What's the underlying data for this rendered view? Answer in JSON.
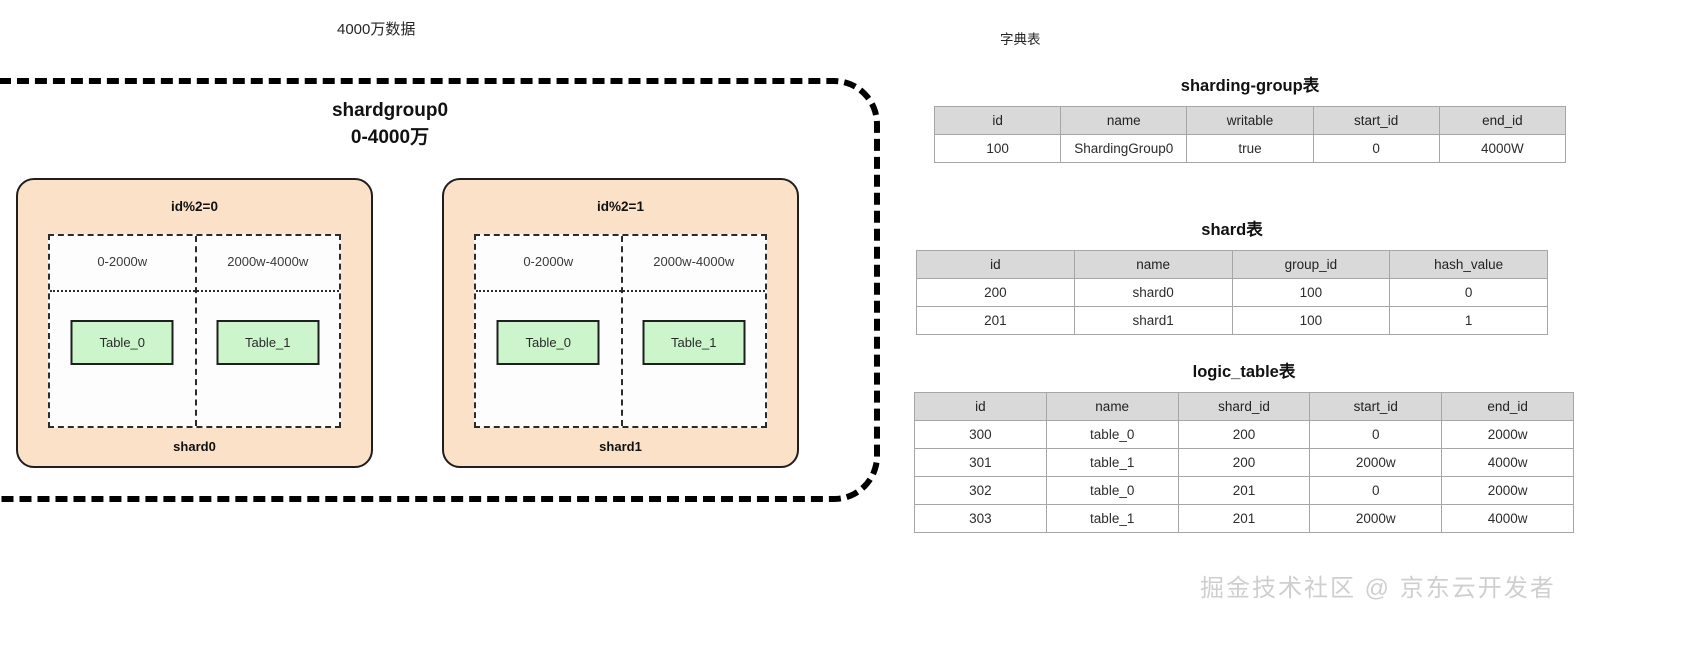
{
  "diagram": {
    "top_caption": "4000万数据",
    "group_title": "shardgroup0\n0-4000万",
    "shards": [
      {
        "mod_label": "id%2=0",
        "name": "shard0",
        "cells": [
          {
            "range": "0-2000w",
            "table": "Table_0"
          },
          {
            "range": "2000w-4000w",
            "table": "Table_1"
          }
        ]
      },
      {
        "mod_label": "id%2=1",
        "name": "shard1",
        "cells": [
          {
            "range": "0-2000w",
            "table": "Table_0"
          },
          {
            "range": "2000w-4000w",
            "table": "Table_1"
          }
        ]
      }
    ]
  },
  "dictionary": {
    "label": "字典表",
    "tables": [
      {
        "title": "sharding-group表",
        "columns": [
          "id",
          "name",
          "writable",
          "start_id",
          "end_id"
        ],
        "rows": [
          [
            "100",
            "ShardingGroup0",
            "true",
            "0",
            "4000W"
          ]
        ]
      },
      {
        "title": "shard表",
        "columns": [
          "id",
          "name",
          "group_id",
          "hash_value"
        ],
        "rows": [
          [
            "200",
            "shard0",
            "100",
            "0"
          ],
          [
            "201",
            "shard1",
            "100",
            "1"
          ]
        ]
      },
      {
        "title": "logic_table表",
        "columns": [
          "id",
          "name",
          "shard_id",
          "start_id",
          "end_id"
        ],
        "rows": [
          [
            "300",
            "table_0",
            "200",
            "0",
            "2000w"
          ],
          [
            "301",
            "table_1",
            "200",
            "2000w",
            "4000w"
          ],
          [
            "302",
            "table_0",
            "201",
            "0",
            "2000w"
          ],
          [
            "303",
            "table_1",
            "201",
            "2000w",
            "4000w"
          ]
        ]
      }
    ]
  },
  "watermark": {
    "text": "掘金技术社区 @ 京东云开发者"
  },
  "colors": {
    "shard_fill": "#fae1c8",
    "table_fill": "#ccf5cc",
    "header_fill": "#d9d9d9",
    "stroke": "#1f1f1f"
  }
}
